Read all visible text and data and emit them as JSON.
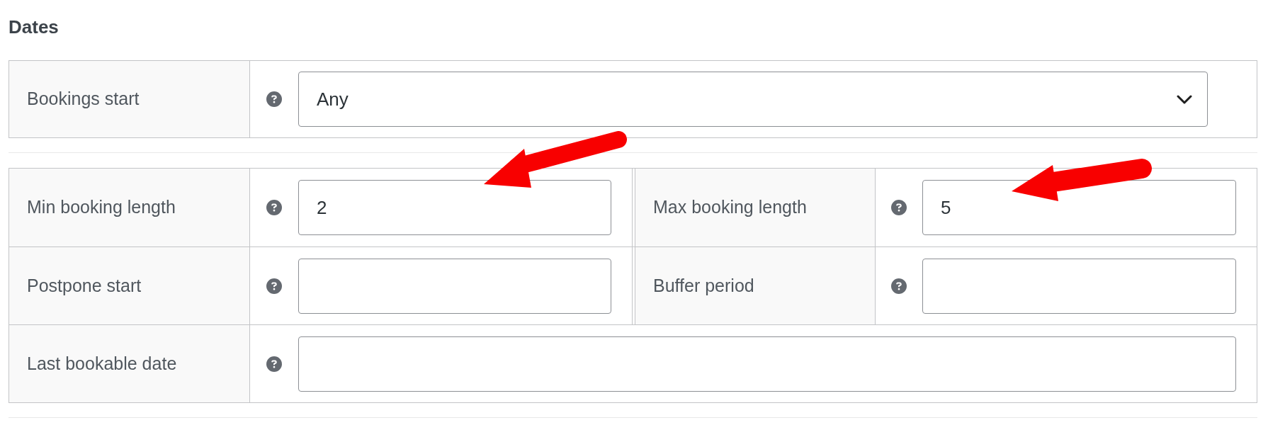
{
  "section": {
    "title": "Dates"
  },
  "bookings_start": {
    "label": "Bookings start",
    "value": "Any"
  },
  "rows": [
    {
      "cells": [
        {
          "label": "Min booking length",
          "value": "2"
        },
        {
          "label": "Max booking length",
          "value": "5"
        }
      ]
    },
    {
      "cells": [
        {
          "label": "Postpone start"
        },
        {
          "label": "Buffer period"
        }
      ]
    },
    {
      "cells": [
        {
          "label": "Last bookable date"
        }
      ]
    }
  ]
}
